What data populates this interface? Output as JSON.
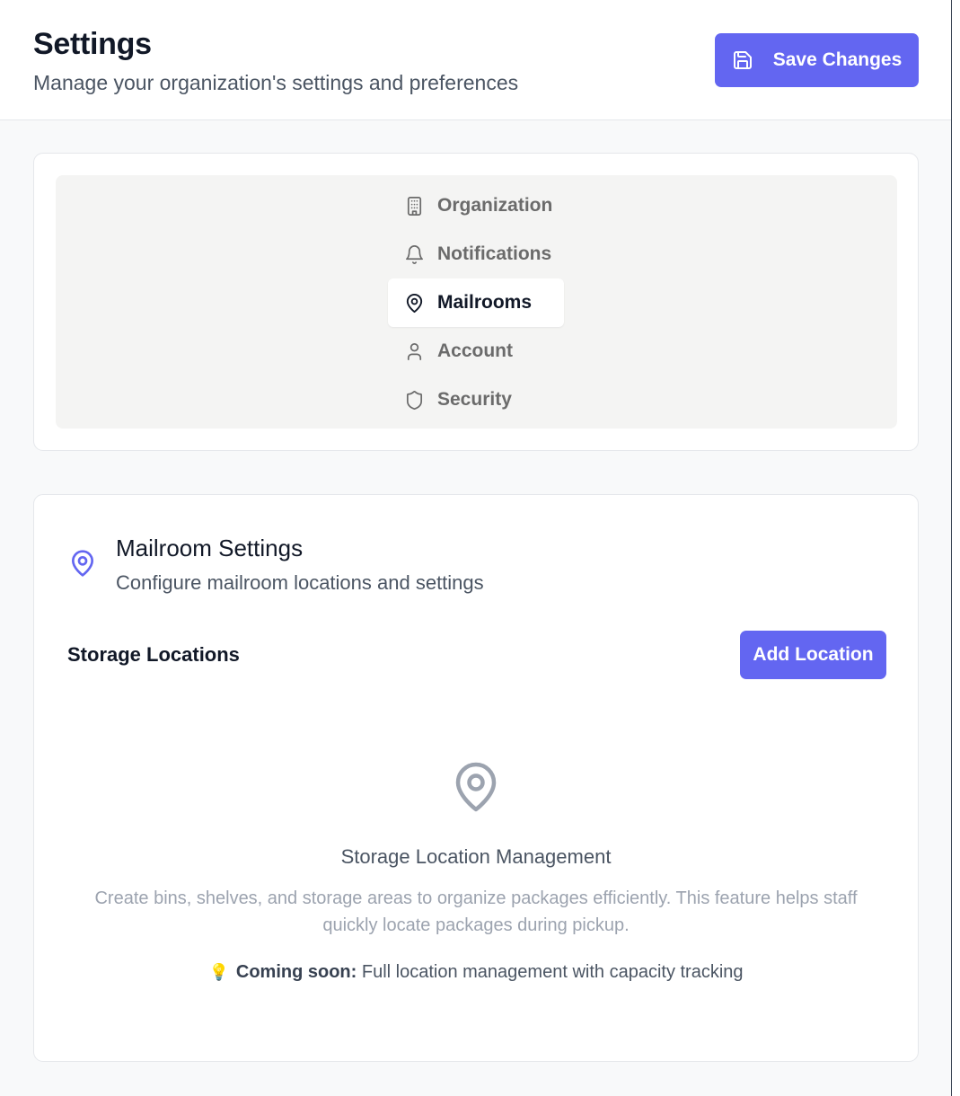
{
  "header": {
    "title": "Settings",
    "subtitle": "Manage your organization's settings and preferences",
    "save_label": "Save Changes"
  },
  "nav": {
    "items": [
      {
        "label": "Organization",
        "icon": "building-icon",
        "active": false
      },
      {
        "label": "Notifications",
        "icon": "bell-icon",
        "active": false
      },
      {
        "label": "Mailrooms",
        "icon": "map-pin-icon",
        "active": true
      },
      {
        "label": "Account",
        "icon": "user-icon",
        "active": false
      },
      {
        "label": "Security",
        "icon": "shield-icon",
        "active": false
      }
    ]
  },
  "mailroom": {
    "title": "Mailroom Settings",
    "subtitle": "Configure mailroom locations and settings",
    "storage_heading": "Storage Locations",
    "add_label": "Add Location",
    "empty_title": "Storage Location Management",
    "empty_desc": "Create bins, shelves, and storage areas to organize packages efficiently. This feature helps staff quickly locate packages during pickup.",
    "coming_soon_icon": "💡",
    "coming_soon_label": "Coming soon:",
    "coming_soon_text": "Full location management with capacity tracking"
  },
  "colors": {
    "accent": "#6366f1",
    "nav_bg": "#f4f4f3"
  }
}
